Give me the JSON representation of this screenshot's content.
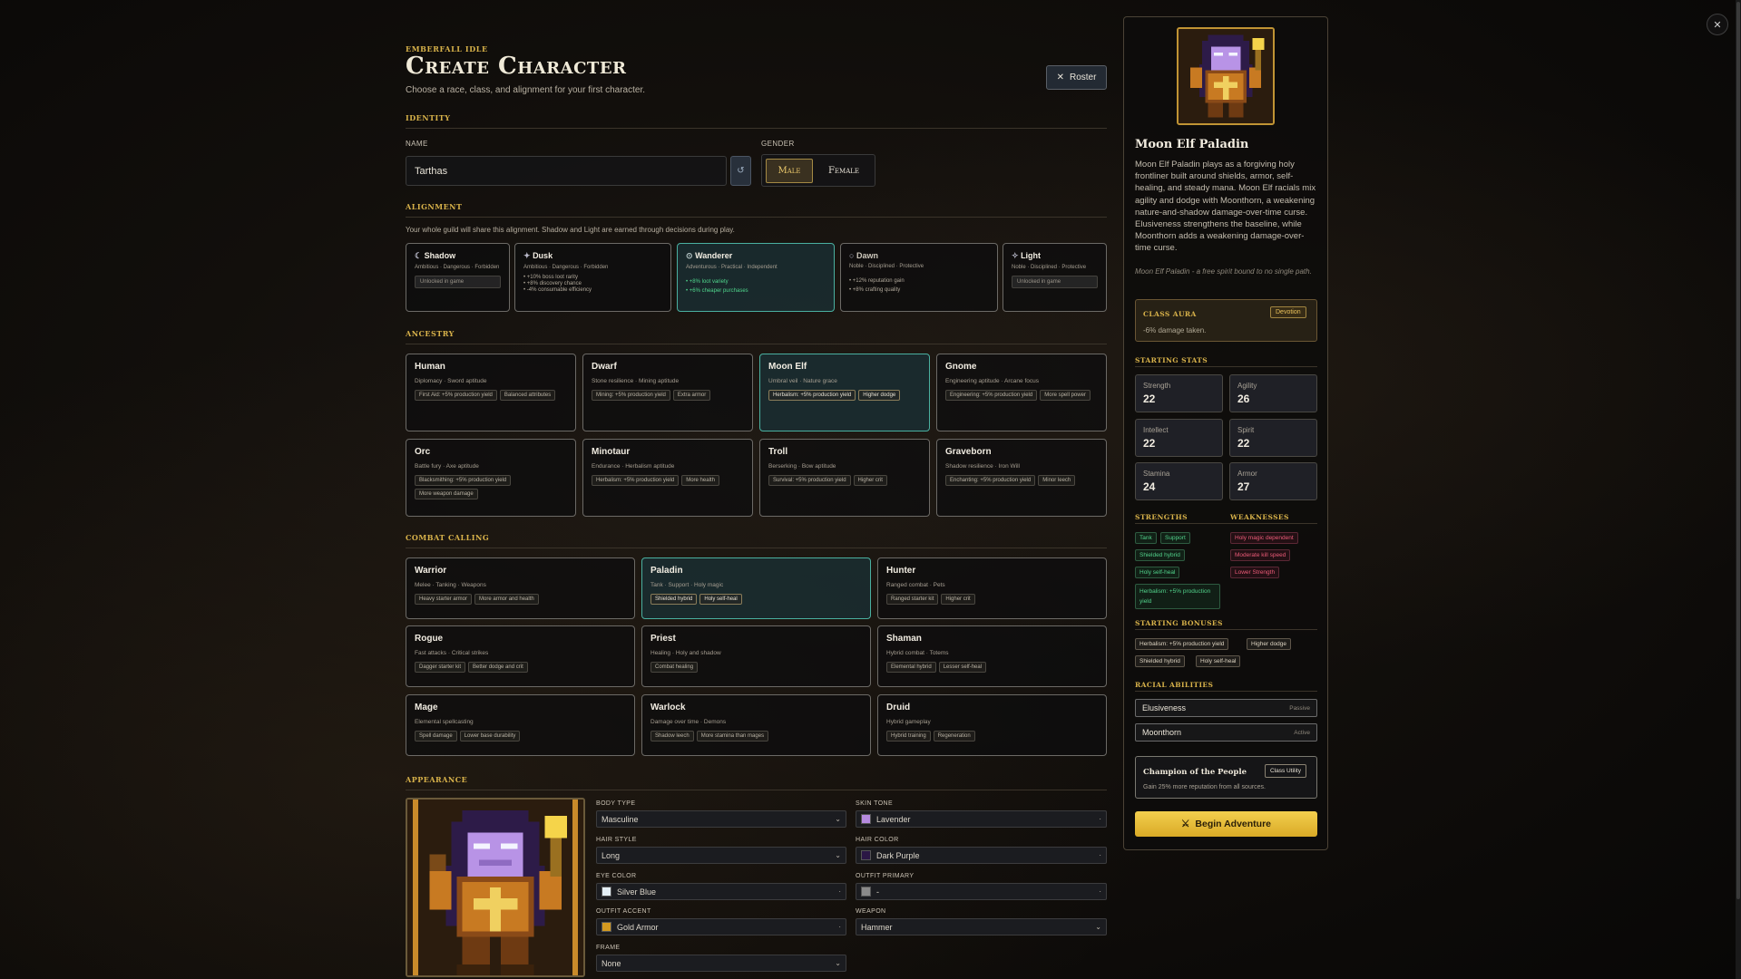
{
  "header": {
    "brand": "Emberfall Idle",
    "title": "Create Character",
    "subtitle": "Choose a race, class, and alignment for your first character.",
    "roster_label": "Roster"
  },
  "identity": {
    "section_label": "Identity",
    "name_label": "Name",
    "name_value": "Tarthas",
    "gender_label": "Gender",
    "gender_options": [
      "Male",
      "Female"
    ],
    "gender_selected": "Male"
  },
  "alignment": {
    "section_label": "Alignment",
    "note": "Your whole guild will share this alignment. Shadow and Light are earned through decisions during play.",
    "options": [
      {
        "name": "Shadow",
        "traits": "Ambitious · Dangerous · Forbidden",
        "locked": "Unlocked in game",
        "bullets": []
      },
      {
        "name": "Dusk",
        "traits": "Ambitious · Dangerous · Forbidden",
        "bullets": [
          "+10% boss loot rarity",
          "+8% discovery chance",
          "-4% consumable efficiency"
        ]
      },
      {
        "name": "Wanderer",
        "traits": "Adventurous · Practical · Independent",
        "bullets": [
          "+8% loot variety",
          "+6% cheaper purchases"
        ],
        "selected": true
      },
      {
        "name": "Dawn",
        "traits": "Noble · Disciplined · Protective",
        "bullets": [
          "+12% reputation gain",
          "+8% crafting quality"
        ]
      },
      {
        "name": "Light",
        "traits": "Noble · Disciplined · Protective",
        "locked": "Unlocked in game",
        "bullets": []
      }
    ]
  },
  "ancestry": {
    "section_label": "Ancestry",
    "races": [
      {
        "name": "Human",
        "sub": "Diplomacy · Sword aptitude",
        "tags": [
          "First Aid: +5% production yield",
          "Balanced attributes"
        ]
      },
      {
        "name": "Dwarf",
        "sub": "Stone resilience · Mining aptitude",
        "tags": [
          "Mining: +5% production yield",
          "Extra armor"
        ]
      },
      {
        "name": "Moon Elf",
        "sub": "Umbral veil · Nature grace",
        "tags": [
          "Herbalism: +5% production yield",
          "Higher dodge"
        ],
        "selected": true
      },
      {
        "name": "Gnome",
        "sub": "Engineering aptitude · Arcane focus",
        "tags": [
          "Engineering: +5% production yield",
          "More spell power"
        ]
      },
      {
        "name": "Orc",
        "sub": "Battle fury · Axe aptitude",
        "tags": [
          "Blacksmithing: +5% production yield",
          "More weapon damage"
        ]
      },
      {
        "name": "Minotaur",
        "sub": "Endurance · Herbalism aptitude",
        "tags": [
          "Herbalism: +5% production yield",
          "More health"
        ]
      },
      {
        "name": "Troll",
        "sub": "Berserking · Bow aptitude",
        "tags": [
          "Survival: +5% production yield",
          "Higher crit"
        ]
      },
      {
        "name": "Graveborn",
        "sub": "Shadow resilience · Iron Will",
        "tags": [
          "Enchanting: +5% production yield",
          "Minor leech"
        ]
      }
    ]
  },
  "calling": {
    "section_label": "Combat Calling",
    "classes": [
      {
        "name": "Warrior",
        "sub": "Melee · Tanking · Weapons",
        "tags": [
          "Heavy starter armor",
          "More armor and health"
        ]
      },
      {
        "name": "Paladin",
        "sub": "Tank · Support · Holy magic",
        "tags": [
          "Shielded hybrid",
          "Holy self-heal"
        ],
        "selected": true
      },
      {
        "name": "Hunter",
        "sub": "Ranged combat · Pets",
        "tags": [
          "Ranged starter kit",
          "Higher crit"
        ]
      },
      {
        "name": "Rogue",
        "sub": "Fast attacks · Critical strikes",
        "tags": [
          "Dagger starter kit",
          "Better dodge and crit"
        ]
      },
      {
        "name": "Priest",
        "sub": "Healing · Holy and shadow",
        "tags": [
          "Combat healing"
        ]
      },
      {
        "name": "Shaman",
        "sub": "Hybrid combat · Totems",
        "tags": [
          "Elemental hybrid",
          "Lesser self-heal"
        ]
      },
      {
        "name": "Mage",
        "sub": "Elemental spellcasting",
        "tags": [
          "Spell damage",
          "Lower base durability"
        ]
      },
      {
        "name": "Warlock",
        "sub": "Damage over time · Demons",
        "tags": [
          "Shadow leech",
          "More stamina than mages"
        ]
      },
      {
        "name": "Druid",
        "sub": "Hybrid gameplay",
        "tags": [
          "Hybrid training",
          "Regeneration"
        ]
      }
    ]
  },
  "appearance": {
    "section_label": "Appearance",
    "fields": {
      "body_type": {
        "label": "Body Type",
        "value": "Masculine"
      },
      "skin_tone": {
        "label": "Skin Tone",
        "value": "Lavender",
        "color": "#b58ae0"
      },
      "hair_style": {
        "label": "Hair Style",
        "value": "Long"
      },
      "hair_color": {
        "label": "Hair Color",
        "value": "Dark Purple",
        "color": "#2b1745"
      },
      "eye_color": {
        "label": "Eye Color",
        "value": "Silver Blue",
        "color": "#e4eef5"
      },
      "outfit_primary": {
        "label": "Outfit Primary",
        "value": "-",
        "color": "#8a8a8a"
      },
      "outfit_accent": {
        "label": "Outfit Accent",
        "value": "Gold Armor",
        "color": "#d49a20"
      },
      "weapon": {
        "label": "Weapon",
        "value": "Hammer"
      },
      "frame": {
        "label": "Frame",
        "value": "None"
      }
    }
  },
  "summary": {
    "title": "Moon Elf Paladin",
    "description": "Moon Elf Paladin plays as a forgiving holy frontliner built around shields, armor, self-healing, and steady mana. Moon Elf racials mix agility and dodge with Moonthorn, a weakening nature-and-shadow damage-over-time curse. Elusiveness strengthens the baseline, while Moonthorn adds a weakening damage-over-time curse.",
    "italic_note": "Moon Elf Paladin - a free spirit bound to no single path.",
    "aura": {
      "label": "Class Aura",
      "badge": "Devotion",
      "text": "-6% damage taken."
    },
    "stats_label": "Starting Stats",
    "stats": [
      {
        "name": "Strength",
        "value": "22"
      },
      {
        "name": "Agility",
        "value": "26"
      },
      {
        "name": "Intellect",
        "value": "22"
      },
      {
        "name": "Spirit",
        "value": "22"
      },
      {
        "name": "Stamina",
        "value": "24"
      },
      {
        "name": "Armor",
        "value": "27"
      }
    ],
    "strengths_label": "Strengths",
    "strengths": [
      "Tank",
      "Support",
      "Shielded hybrid",
      "Holy self-heal",
      "Herbalism: +5% production yield"
    ],
    "weaknesses_label": "Weaknesses",
    "weaknesses": [
      "Holy magic dependent",
      "Moderate kill speed",
      "Lower Strength"
    ],
    "bonuses_label": "Starting Bonuses",
    "bonuses": [
      "Herbalism: +5% production yield",
      "Higher dodge",
      "Shielded hybrid",
      "Holy self-heal"
    ],
    "racial_label": "Racial Abilities",
    "racials": [
      {
        "name": "Elusiveness",
        "type": "Passive"
      },
      {
        "name": "Moonthorn",
        "type": "Active"
      }
    ],
    "utility": {
      "name": "Champion of the People",
      "badge": "Class Utility",
      "text": "Gain 25% more reputation from all sources."
    },
    "begin_label": "Begin Adventure"
  },
  "colors": {
    "accent_gold": "#d8b24a",
    "selected_teal": "#4ab0a0",
    "strength_green": "#51d18a",
    "weakness_red": "#ec5b78"
  },
  "icons": {
    "close": "close-icon",
    "reroll": "refresh-icon",
    "begin": "crossed-swords-icon"
  }
}
